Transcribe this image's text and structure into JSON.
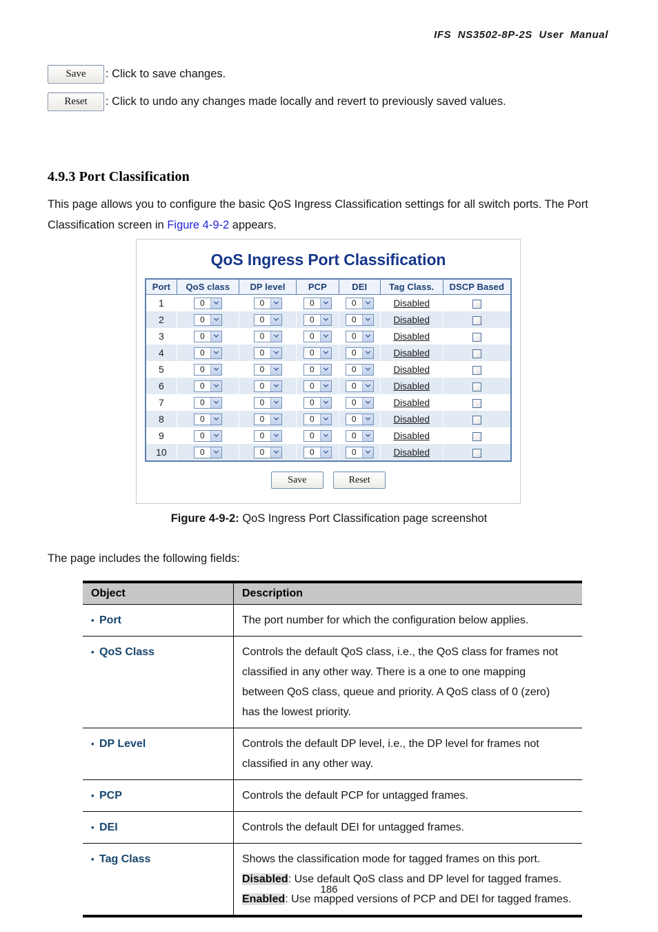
{
  "document": {
    "running_header": "IFS  NS3502-8P-2S  User  Manual",
    "page_number": "186"
  },
  "legend": {
    "save_button": "Save",
    "save_description": ": Click to save changes.",
    "reset_button": "Reset",
    "reset_description": ": Click to undo any changes made locally and revert to previously saved values."
  },
  "section": {
    "heading": "4.9.3 Port Classification",
    "intro_part1": "This page allows you to configure the basic QoS Ingress Classification settings for all switch ports. The Port Classification screen in ",
    "intro_xref": "Figure 4-9-2",
    "intro_part2": " appears."
  },
  "figure": {
    "screenshot": {
      "title": "QoS Ingress Port Classification",
      "columns": [
        "Port",
        "QoS class",
        "DP level",
        "PCP",
        "DEI",
        "Tag Class.",
        "DSCP Based"
      ],
      "rows": [
        {
          "port": "1",
          "qos_class": "0",
          "dp_level": "0",
          "pcp": "0",
          "dei": "0",
          "tag_class": "Disabled",
          "dscp_based": false
        },
        {
          "port": "2",
          "qos_class": "0",
          "dp_level": "0",
          "pcp": "0",
          "dei": "0",
          "tag_class": "Disabled",
          "dscp_based": false
        },
        {
          "port": "3",
          "qos_class": "0",
          "dp_level": "0",
          "pcp": "0",
          "dei": "0",
          "tag_class": "Disabled",
          "dscp_based": false
        },
        {
          "port": "4",
          "qos_class": "0",
          "dp_level": "0",
          "pcp": "0",
          "dei": "0",
          "tag_class": "Disabled",
          "dscp_based": false
        },
        {
          "port": "5",
          "qos_class": "0",
          "dp_level": "0",
          "pcp": "0",
          "dei": "0",
          "tag_class": "Disabled",
          "dscp_based": false
        },
        {
          "port": "6",
          "qos_class": "0",
          "dp_level": "0",
          "pcp": "0",
          "dei": "0",
          "tag_class": "Disabled",
          "dscp_based": false
        },
        {
          "port": "7",
          "qos_class": "0",
          "dp_level": "0",
          "pcp": "0",
          "dei": "0",
          "tag_class": "Disabled",
          "dscp_based": false
        },
        {
          "port": "8",
          "qos_class": "0",
          "dp_level": "0",
          "pcp": "0",
          "dei": "0",
          "tag_class": "Disabled",
          "dscp_based": false
        },
        {
          "port": "9",
          "qos_class": "0",
          "dp_level": "0",
          "pcp": "0",
          "dei": "0",
          "tag_class": "Disabled",
          "dscp_based": false
        },
        {
          "port": "10",
          "qos_class": "0",
          "dp_level": "0",
          "pcp": "0",
          "dei": "0",
          "tag_class": "Disabled",
          "dscp_based": false
        }
      ],
      "save_button": "Save",
      "reset_button": "Reset",
      "title_color": "#17368a"
    },
    "caption_label": "Figure 4-9-2:",
    "caption_text": " QoS Ingress Port Classification page screenshot"
  },
  "fields_intro": "The page includes the following fields:",
  "description_table": {
    "headers": {
      "object": "Object",
      "description": "Description"
    },
    "rows": [
      {
        "object": "Port",
        "lines": [
          "The port number for which the configuration below applies."
        ]
      },
      {
        "object": "QoS Class",
        "lines": [
          "Controls the default QoS class, i.e., the QoS class for frames not",
          "classified in any other way. There is a one to one mapping",
          "between QoS class, queue and priority. A QoS class of 0 (zero)",
          "has the lowest priority."
        ]
      },
      {
        "object": "DP Level",
        "lines": [
          "Controls the default DP level, i.e., the DP level for frames not",
          "classified in any other way."
        ]
      },
      {
        "object": "PCP",
        "lines": [
          "Controls the default PCP for untagged frames."
        ]
      },
      {
        "object": "DEI",
        "lines": [
          "Controls the default DEI for untagged frames."
        ]
      },
      {
        "object": "Tag Class",
        "lines": [
          "Shows the classification mode for tagged frames on this port."
        ],
        "highlighted_lines": [
          {
            "term": "Disabled",
            "rest": ": Use default QoS class and DP level for tagged frames."
          },
          {
            "term": "Enabled",
            "rest": ": Use mapped versions of PCP and DEI for tagged frames."
          }
        ]
      }
    ]
  }
}
